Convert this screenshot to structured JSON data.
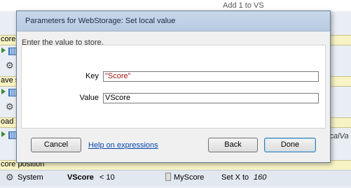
{
  "background": {
    "row1_frag": "∨ ",
    "row1_right": "Add 1 to VS",
    "comment1": "core",
    "comment2": "ave s",
    "comment3": "oad s",
    "comment4": "core position",
    "right_italic": "localVa",
    "sys_row": {
      "object": "System",
      "condition_object": "VScore",
      "condition_rest": "< 10",
      "action_object": "MyScore",
      "action_text": "Set X to",
      "action_value": "160"
    }
  },
  "dialog": {
    "title": "Parameters for WebStorage: Set local value",
    "description": "Enter the value to store.",
    "params": [
      {
        "label": "Key",
        "value": "\"Score\""
      },
      {
        "label": "Value",
        "value": "VScore"
      }
    ],
    "buttons": {
      "cancel": "Cancel",
      "help": "Help on expressions",
      "back": "Back",
      "done": "Done"
    }
  },
  "colors": {
    "key_value_text": "#a31515",
    "accent": "#3c7fb1"
  }
}
